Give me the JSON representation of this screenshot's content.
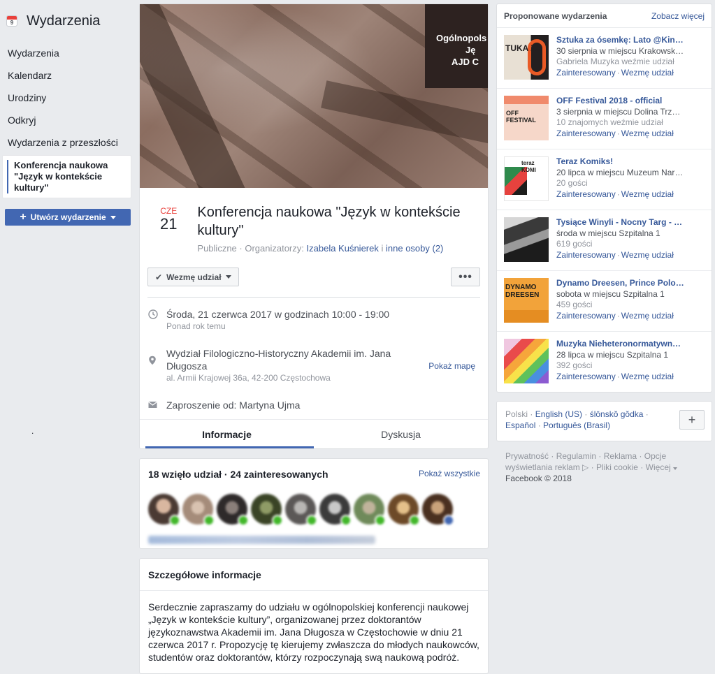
{
  "sidebar": {
    "title": "Wydarzenia",
    "calendar_day": "9",
    "items": [
      "Wydarzenia",
      "Kalendarz",
      "Urodziny",
      "Odkryj",
      "Wydarzenia z przeszłości"
    ],
    "active_item": "Konferencja naukowa \"Język w kontekście kultury\"",
    "create_label": "Utwórz wydarzenie",
    "stray_dot": "."
  },
  "event": {
    "cover_text": [
      "Ogólnopols",
      "Ję",
      "AJD C"
    ],
    "month": "CZE",
    "day": "21",
    "title": "Konferencja naukowa \"Język w kontekście kultury\"",
    "privacy": "Publiczne",
    "organizers_label": "Organizatorzy:",
    "organizer": "Izabela Kuśnierek",
    "and_text": "i",
    "others": "inne osoby (2)",
    "going_button": "Wezmę udział",
    "more_button": "•••",
    "time_main": "Środa, 21 czerwca 2017 w godzinach 10:00 - 19:00",
    "time_sub": "Ponad rok temu",
    "place_main": "Wydział Filologiczno-Historyczny Akademii im. Jana Długosza",
    "place_sub": "al. Armii Krajowej 36a, 42-200 Częstochowa",
    "map_link": "Pokaż mapę",
    "invite": "Zaproszenie od: Martyna Ujma",
    "tabs": [
      "Informacje",
      "Dyskusja"
    ]
  },
  "attendance": {
    "summary": "18 wzięło udział · 24 zainteresowanych",
    "show_all": "Pokaż wszystkie"
  },
  "details": {
    "heading": "Szczegółowe informacje",
    "body": "Serdecznie zapraszamy do udziału w ogólnopolskiej konferencji naukowej „Język w kontekście kultury”, organizowanej przez doktorantów językoznawstwa Akademii im. Jana Długosza w Częstochowie w dniu 21 czerwca 2017 r. Propozycję tę kierujemy zwłaszcza do młodych naukowców, studentów oraz doktorantów, którzy rozpoczynają swą naukową podróż."
  },
  "suggested": {
    "heading": "Proponowane wydarzenia",
    "see_more": "Zobacz więcej",
    "interested_label": "Zainteresowany",
    "going_label": "Wezmę udział",
    "items": [
      {
        "title": "Sztuka za ósemkę: Lato @Kin…",
        "line1": "30 sierpnia w miejscu Krakowsk…",
        "line2": "Gabriela Muzyka weźmie udział",
        "thumb_text": "TUKA ZA"
      },
      {
        "title": "OFF Festival 2018 - official",
        "line1": "3 sierpnia w miejscu Dolina Trz…",
        "line2": "10 znajomych weźmie udział",
        "thumb_text": "OFF FESTIVAL"
      },
      {
        "title": "Teraz Komiks!",
        "line1": "20 lipca w miejscu Muzeum Nar…",
        "line2": "20 gości",
        "thumb_text": "teraz KOMI"
      },
      {
        "title": "Tysiące Winyli - Nocny Targ - …",
        "line1": "środa w miejscu Szpitalna 1",
        "line2": "619 gości",
        "thumb_text": ""
      },
      {
        "title": "Dynamo Dreesen, Prince Polo…",
        "line1": "sobota w miejscu Szpitalna 1",
        "line2": "459 gości",
        "thumb_text": "DYNAMO DREESEN"
      },
      {
        "title": "Muzyka Nieheteronormatywn…",
        "line1": "28 lipca w miejscu Szpitalna 1",
        "line2": "392 gości",
        "thumb_text": ""
      }
    ]
  },
  "languages": {
    "current": "Polski",
    "links": [
      "English (US)",
      "ślōnskŏ gŏdka",
      "Español",
      "Português (Brasil)"
    ],
    "add": "+"
  },
  "footer": {
    "links": [
      "Prywatność",
      "Regulamin",
      "Reklama",
      "Opcje wyświetlania reklam",
      "Pliki cookie",
      "Więcej"
    ],
    "copyright": "Facebook © 2018"
  }
}
